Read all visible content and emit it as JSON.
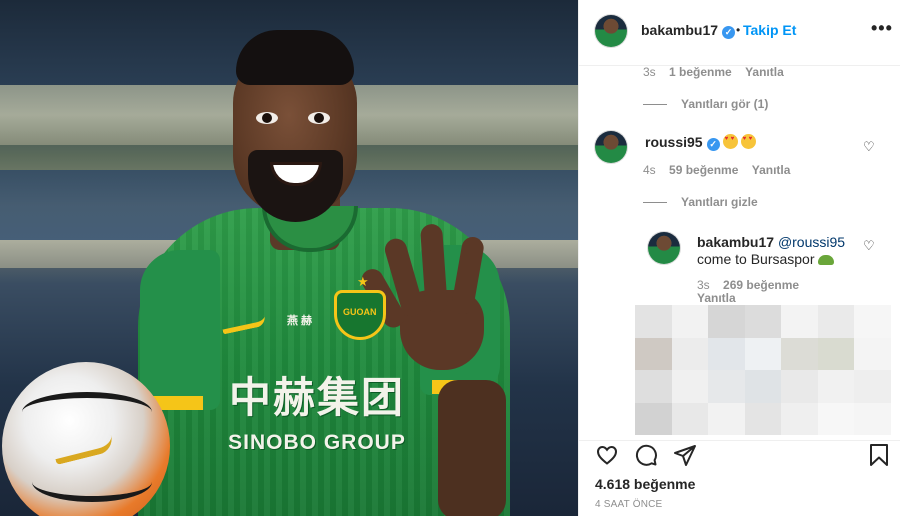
{
  "header": {
    "username": "bakambu17",
    "separator": "•",
    "follow_label": "Takip Et",
    "more_label": "•••"
  },
  "comments": {
    "prev_meta": {
      "time": "3s",
      "likes": "1 beğenme",
      "reply": "Yanıtla"
    },
    "view_replies": "Yanıtları gör (1)",
    "main": {
      "username": "roussi95",
      "time": "4s",
      "likes": "59 beğenme",
      "reply": "Yanıtla"
    },
    "hide_replies": "Yanıtları gizle",
    "reply": {
      "username": "bakambu17",
      "mention": "@roussi95",
      "text": "come to Bursaspor",
      "time": "3s",
      "likes": "269 beğenme",
      "reply": "Yanıtla"
    }
  },
  "photo": {
    "sponsor_cn": "中赫集团",
    "sponsor_en": "SINOBO GROUP",
    "patch": "燕 赫",
    "crest": "GUOAN"
  },
  "footer": {
    "likes": "4.618 beğenme",
    "time": "4 SAAT ÖNCE"
  },
  "colors": {
    "accent": "#0095f6",
    "verified": "#3897f0",
    "muted": "#8e8e8e",
    "text": "#262626"
  },
  "icons": [
    "verified-badge-icon",
    "more-icon",
    "heart-icon",
    "comment-icon",
    "share-icon",
    "bookmark-icon"
  ]
}
